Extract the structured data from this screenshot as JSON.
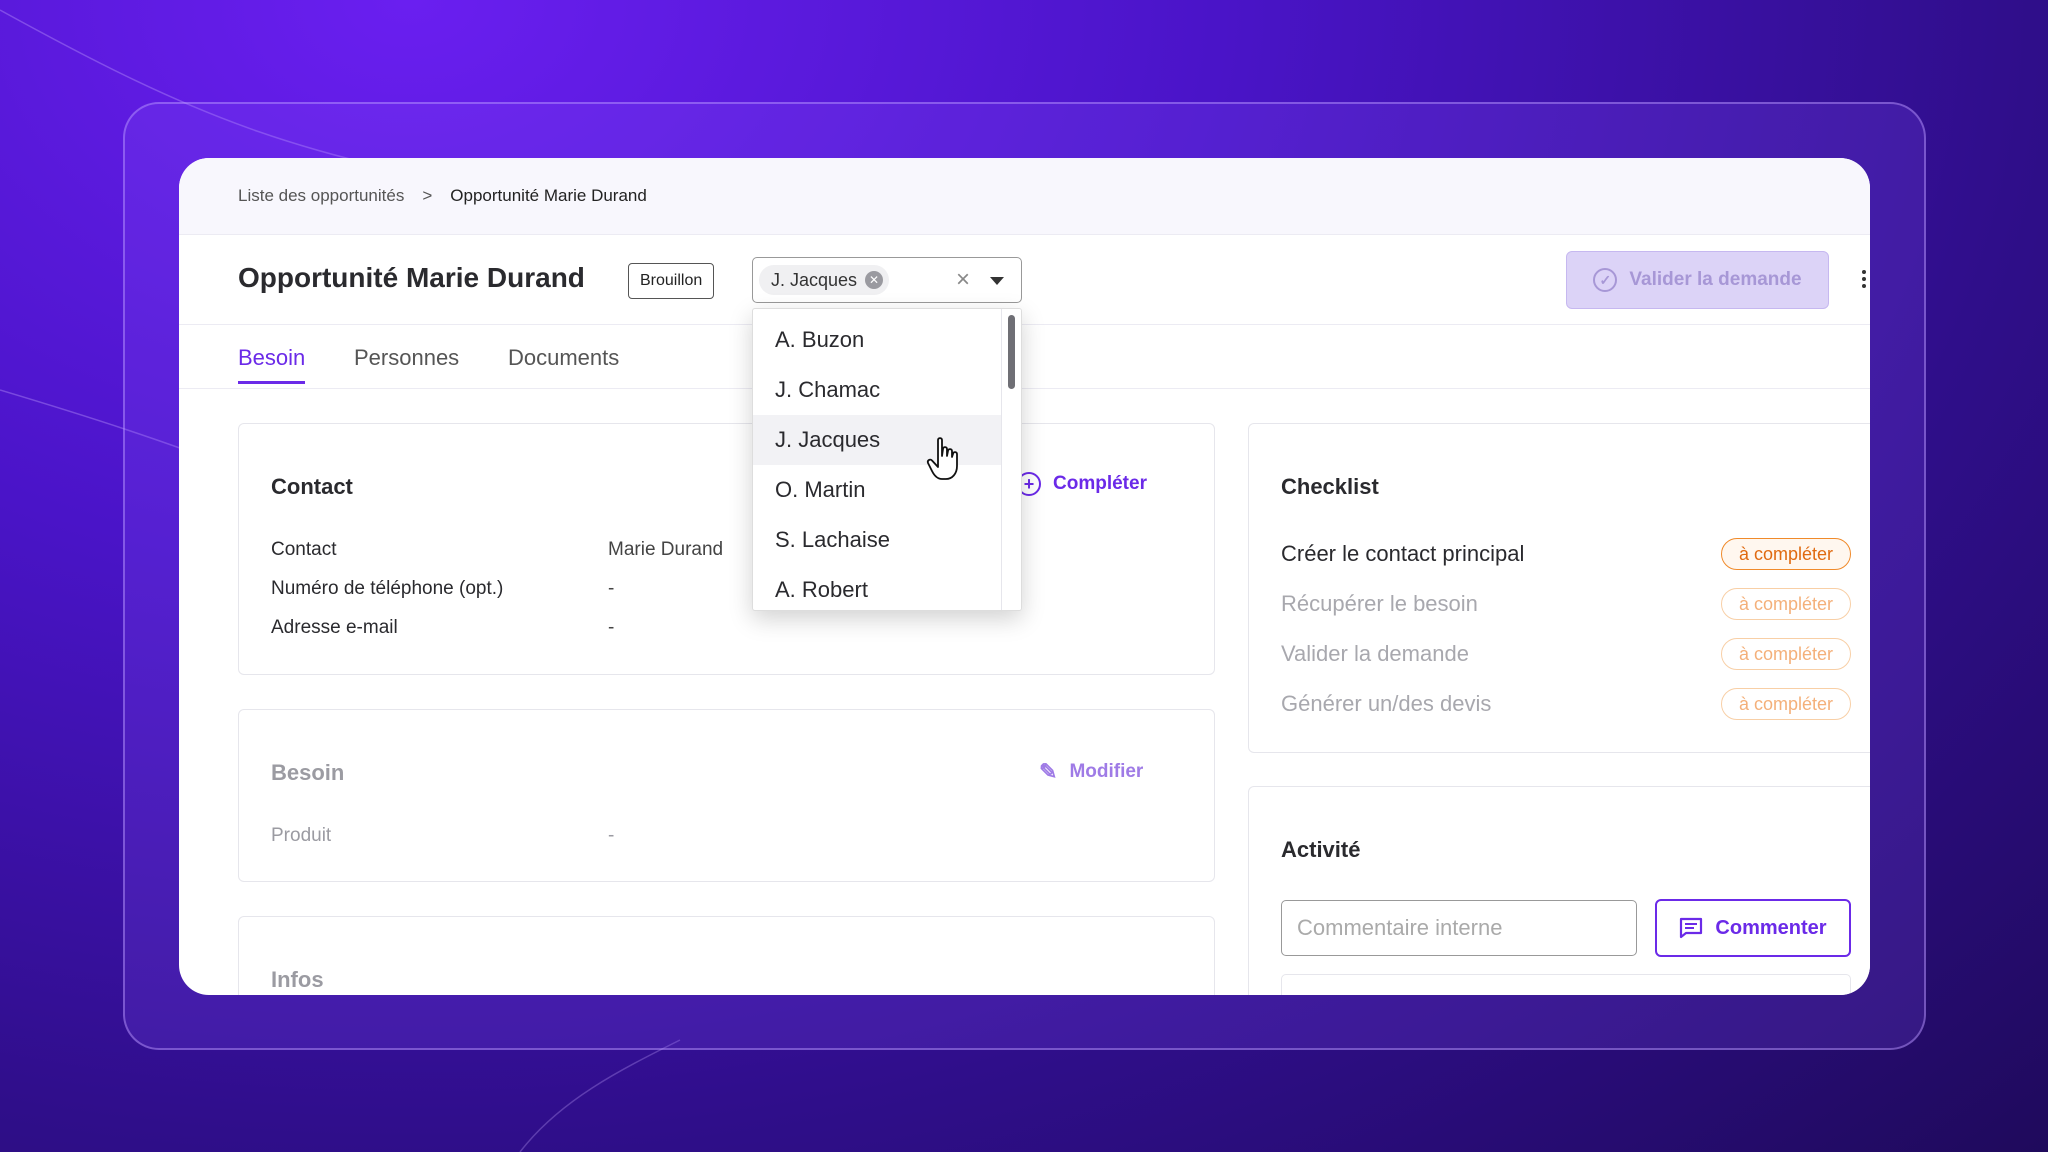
{
  "breadcrumb": {
    "parent": "Liste des opportunités",
    "separator": ">",
    "current": "Opportunité Marie Durand"
  },
  "header": {
    "title": "Opportunité Marie Durand",
    "status_badge": "Brouillon",
    "assignee_chip": "J. Jacques",
    "validate_label": "Valider la demande"
  },
  "tabs": [
    {
      "label": "Besoin"
    },
    {
      "label": "Personnes"
    },
    {
      "label": "Documents"
    }
  ],
  "dropdown": {
    "options": [
      "A. Buzon",
      "J. Chamac",
      "J. Jacques",
      "O. Martin",
      "S. Lachaise",
      "A. Robert"
    ],
    "hovered": "J. Jacques"
  },
  "contact_card": {
    "title": "Contact",
    "action": "Compléter",
    "rows": [
      {
        "label": "Contact",
        "value": "Marie Durand"
      },
      {
        "label": "Numéro de téléphone (opt.)",
        "value": "-"
      },
      {
        "label": "Adresse e-mail",
        "value": "-"
      }
    ]
  },
  "besoin_card": {
    "title": "Besoin",
    "action": "Modifier",
    "rows": [
      {
        "label": "Produit",
        "value": "-"
      }
    ]
  },
  "infos_card": {
    "title": "Infos"
  },
  "checklist": {
    "title": "Checklist",
    "items": [
      {
        "label": "Créer le contact principal",
        "status": "à compléter"
      },
      {
        "label": "Récupérer le besoin",
        "status": "à compléter"
      },
      {
        "label": "Valider la demande",
        "status": "à compléter"
      },
      {
        "label": "Générer un/des devis",
        "status": "à compléter"
      }
    ]
  },
  "activity": {
    "title": "Activité",
    "comment_placeholder": "Commentaire interne",
    "comment_button": "Commenter"
  },
  "colors": {
    "accent": "#6b2ae8",
    "warning": "#f08a2a",
    "background": "#4a14c8"
  }
}
